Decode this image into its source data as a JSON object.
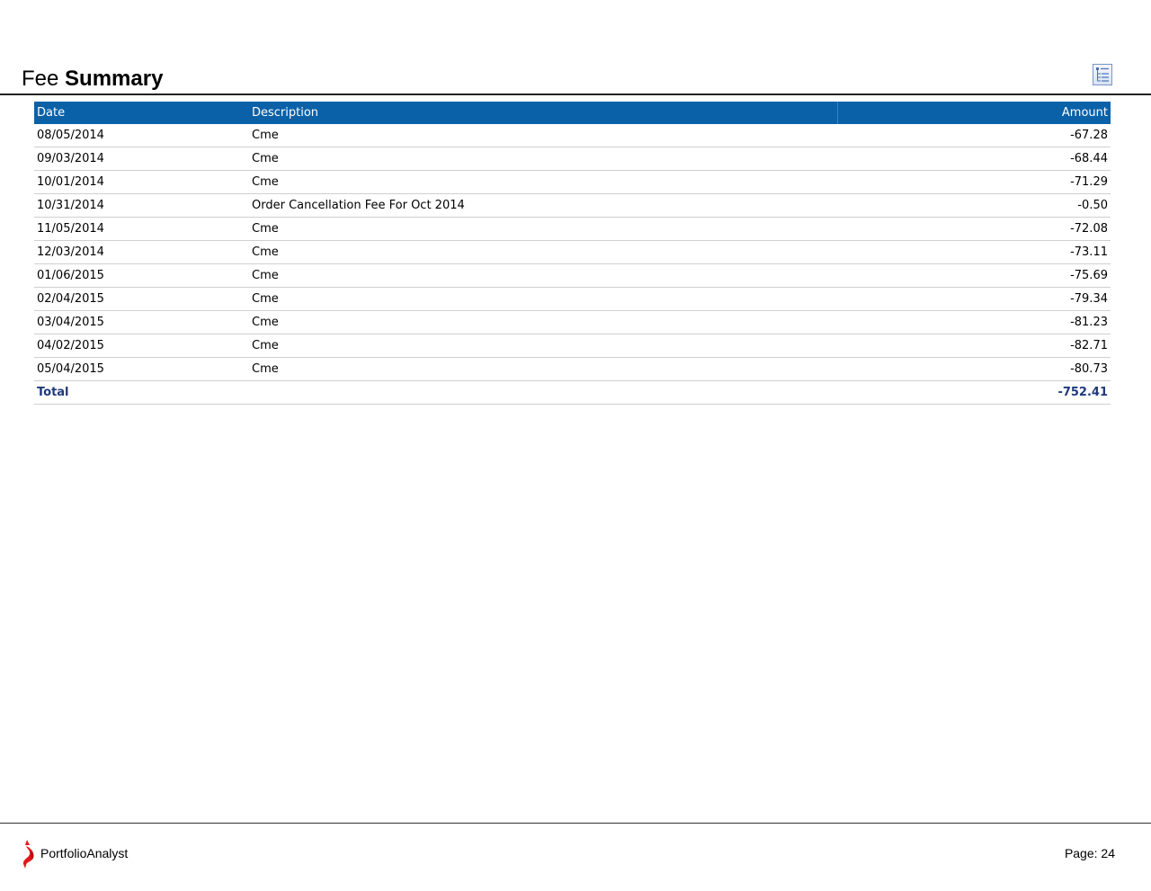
{
  "header": {
    "title_light": "Fee",
    "title_bold": "Summary",
    "icon": "report-options-icon"
  },
  "table": {
    "columns": [
      "Date",
      "Description",
      "Amount"
    ],
    "rows": [
      {
        "date": "08/05/2014",
        "description": "Cme",
        "amount": "-67.28"
      },
      {
        "date": "09/03/2014",
        "description": "Cme",
        "amount": "-68.44"
      },
      {
        "date": "10/01/2014",
        "description": "Cme",
        "amount": "-71.29"
      },
      {
        "date": "10/31/2014",
        "description": "Order Cancellation Fee For Oct 2014",
        "amount": "-0.50"
      },
      {
        "date": "11/05/2014",
        "description": "Cme",
        "amount": "-72.08"
      },
      {
        "date": "12/03/2014",
        "description": "Cme",
        "amount": "-73.11"
      },
      {
        "date": "01/06/2015",
        "description": "Cme",
        "amount": "-75.69"
      },
      {
        "date": "02/04/2015",
        "description": "Cme",
        "amount": "-79.34"
      },
      {
        "date": "03/04/2015",
        "description": "Cme",
        "amount": "-81.23"
      },
      {
        "date": "04/02/2015",
        "description": "Cme",
        "amount": "-82.71"
      },
      {
        "date": "05/04/2015",
        "description": "Cme",
        "amount": "-80.73"
      }
    ],
    "total": {
      "label": "Total",
      "amount": "-752.41"
    }
  },
  "footer": {
    "brand": "PortfolioAnalyst",
    "page_label": "Page: 24",
    "logo_icon": "portfolioanalyst-logo-icon"
  },
  "colors": {
    "header_bg": "#0a61a8",
    "total_text": "#1f3a7a",
    "logo_red": "#e4171b"
  }
}
